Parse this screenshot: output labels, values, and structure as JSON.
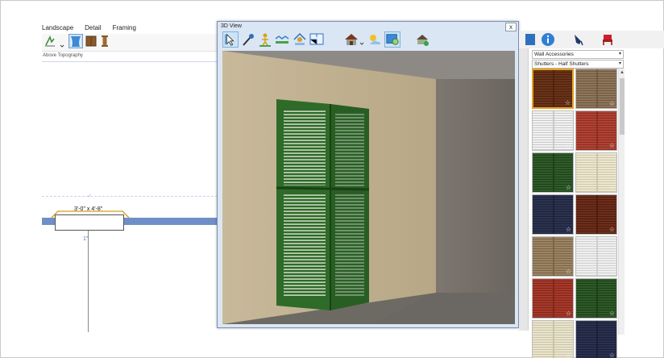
{
  "menu": {
    "items": [
      "Landscape",
      "Detail",
      "Framing"
    ],
    "group_label": "Above Topography"
  },
  "plan": {
    "dimension_label": "3'-0\" x 4'-8\"",
    "offset_label": "1\""
  },
  "view3d": {
    "title": "3D View",
    "close_glyph": "x",
    "toolbar_icons": [
      "select-objects-icon",
      "eyedropper-icon",
      "walkthrough-icon",
      "camera-icon",
      "dollhouse-icon",
      "floor-plan-icon",
      "house-icon",
      "sun-icon",
      "render-icon",
      "exterior-icon"
    ]
  },
  "library": {
    "tab_icons": [
      "info-icon",
      "pen-icon",
      "chair-icon"
    ],
    "category": "Wall Accessories",
    "subcategory": "Shutters - Half Shutters",
    "swatches": [
      {
        "color": "#6a3318",
        "slat": "#4e230f",
        "selected": true
      },
      {
        "color": "#8e7559",
        "slat": "#6f5a42",
        "selected": false
      },
      {
        "color": "#f2f2f2",
        "slat": "#c9c9c9",
        "selected": false
      },
      {
        "color": "#b24233",
        "slat": "#8a2f24",
        "selected": false
      },
      {
        "color": "#2f5b2a",
        "slat": "#1f4019",
        "selected": false
      },
      {
        "color": "#ece7cf",
        "slat": "#cdc6a8",
        "selected": false
      },
      {
        "color": "#2b3350",
        "slat": "#1c2238",
        "selected": false
      },
      {
        "color": "#6e2e1a",
        "slat": "#4b1e10",
        "selected": false
      },
      {
        "color": "#9c8463",
        "slat": "#7a6548",
        "selected": false
      },
      {
        "color": "#efefef",
        "slat": "#cfcfcf",
        "selected": false
      },
      {
        "color": "#a8392a",
        "slat": "#7f281d",
        "selected": false
      },
      {
        "color": "#2e5a28",
        "slat": "#1d3e18",
        "selected": false
      },
      {
        "color": "#e9e4cd",
        "slat": "#cac3a6",
        "selected": false
      },
      {
        "color": "#2a3150",
        "slat": "#1b2037",
        "selected": false
      }
    ],
    "star_glyph": "☆"
  }
}
